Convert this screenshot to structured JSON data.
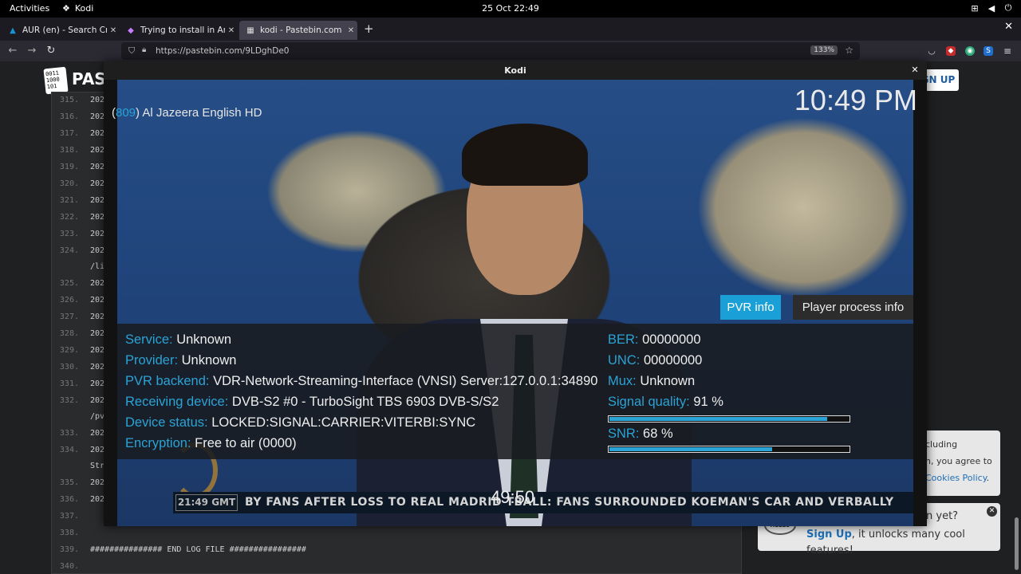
{
  "topbar": {
    "activities": "Activities",
    "app_name": "Kodi",
    "clock": "25 Oct  22:49"
  },
  "tabs": [
    {
      "title": "AUR (en) - Search Criteria",
      "icon": "arch-icon"
    },
    {
      "title": "Trying to install in Arch - K",
      "icon": "forum-icon"
    },
    {
      "title": "kodi - Pastebin.com",
      "icon": "pastebin-icon"
    }
  ],
  "navbar": {
    "url": "https://pastebin.com/9LDghDe0",
    "zoom": "133%"
  },
  "pastebin": {
    "logo_text": "0011\n1000\n101",
    "name": "PAS",
    "signup_button": "GN UP",
    "lines": [
      {
        "n": "315.",
        "t": "202"
      },
      {
        "n": "316.",
        "t": "202"
      },
      {
        "n": "317.",
        "t": "202"
      },
      {
        "n": "318.",
        "t": "202"
      },
      {
        "n": "319.",
        "t": "202"
      },
      {
        "n": "320.",
        "t": "202"
      },
      {
        "n": "321.",
        "t": "202"
      },
      {
        "n": "322.",
        "t": "202"
      },
      {
        "n": "323.",
        "t": "202"
      },
      {
        "n": "324.",
        "t": "202"
      },
      {
        "n": "",
        "t": "/li"
      },
      {
        "n": "325.",
        "t": "202"
      },
      {
        "n": "326.",
        "t": "202"
      },
      {
        "n": "327.",
        "t": "202"
      },
      {
        "n": "328.",
        "t": "202"
      },
      {
        "n": "329.",
        "t": "202"
      },
      {
        "n": "330.",
        "t": "202"
      },
      {
        "n": "331.",
        "t": "202"
      },
      {
        "n": "332.",
        "t": "202"
      },
      {
        "n": "",
        "t": "/pv"
      },
      {
        "n": "333.",
        "t": "202"
      },
      {
        "n": "334.",
        "t": "202"
      },
      {
        "n": "",
        "t": "Str"
      },
      {
        "n": "335.",
        "t": "202"
      },
      {
        "n": "336.",
        "t": "202"
      },
      {
        "n": "337.",
        "t": ""
      },
      {
        "n": "338.",
        "t": ""
      },
      {
        "n": "339.",
        "t": "############### END LOG FILE ################"
      },
      {
        "n": "340.",
        "t": ""
      }
    ],
    "cookie": {
      "line1": "cluding",
      "line2": "n, you agree to",
      "link": "Cookies Policy",
      "tail": "."
    },
    "signup_card": {
      "hello": "HELLO",
      "question": "n yet?",
      "link": "Sign Up",
      "rest": ", it unlocks many cool features!"
    }
  },
  "kodi": {
    "window_title": "Kodi",
    "channel_number": "809",
    "channel_name": "Al Jazeera English HD",
    "clock": "10:49 PM",
    "buttons": {
      "pvr_info": "PVR info",
      "player_process_info": "Player process info"
    },
    "info_left": [
      {
        "key": "Service:",
        "value": "Unknown"
      },
      {
        "key": "Provider:",
        "value": "Unknown"
      },
      {
        "key": "PVR backend:",
        "value": "VDR-Network-Streaming-Interface (VNSI) Server:127.0.0.1:34890"
      },
      {
        "key": "Receiving device:",
        "value": "DVB-S2 #0 - TurboSight TBS 6903 DVB-S/S2"
      },
      {
        "key": "Device status:",
        "value": "LOCKED:SIGNAL:CARRIER:VITERBI:SYNC"
      },
      {
        "key": "Encryption:",
        "value": "Free to air (0000)"
      }
    ],
    "info_right": {
      "ber": {
        "key": "BER:",
        "value": "00000000"
      },
      "unc": {
        "key": "UNC:",
        "value": "00000000"
      },
      "mux": {
        "key": "Mux:",
        "value": "Unknown"
      },
      "signal_quality": {
        "key": "Signal quality:",
        "value": "91 %",
        "level": 0.91
      },
      "snr": {
        "key": "SNR:",
        "value": "68 %",
        "level": 0.68
      }
    },
    "ticker": {
      "time": "21:49 GMT",
      "text": "BY FANS AFTER LOSS TO REAL MADRID        TBALL: FANS SURROUNDED KOEMAN'S CAR AND VERBALLY"
    },
    "elapsed": "49:50"
  },
  "colors": {
    "kodi_accent": "#2aa3d6",
    "pvr_button": "#1aa0d6"
  }
}
